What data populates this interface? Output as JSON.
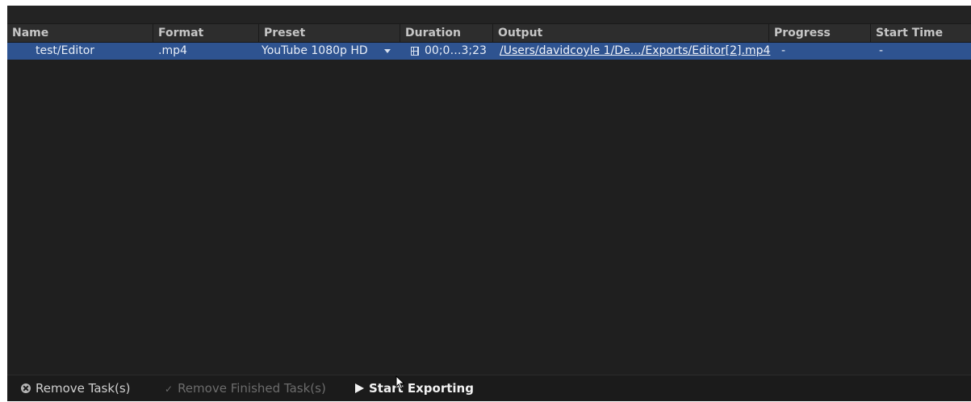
{
  "table": {
    "columns": {
      "name": "Name",
      "format": "Format",
      "preset": "Preset",
      "duration": "Duration",
      "output": "Output",
      "progress": "Progress",
      "start_time": "Start Time"
    },
    "rows": [
      {
        "name": "test/Editor",
        "format": ".mp4",
        "preset": "YouTube 1080p HD",
        "duration": "00;0…3;23",
        "output": "/Users/davidcoyle 1/De…/Exports/Editor[2].mp4",
        "progress": "-",
        "start_time": "-",
        "selected": true
      }
    ]
  },
  "footer": {
    "remove_tasks": "Remove Task(s)",
    "remove_finished": "Remove Finished Task(s)",
    "start_exporting": "Start Exporting"
  },
  "colors": {
    "panel_bg": "#1f1f1f",
    "header_bg": "#2d2d2d",
    "selected_row": "#2e5390"
  },
  "icons": {
    "remove": "remove-icon",
    "check": "check-icon",
    "play": "play-icon",
    "dropdown": "dropdown-arrow-icon",
    "film": "film-icon",
    "cursor": "cursor-icon"
  }
}
